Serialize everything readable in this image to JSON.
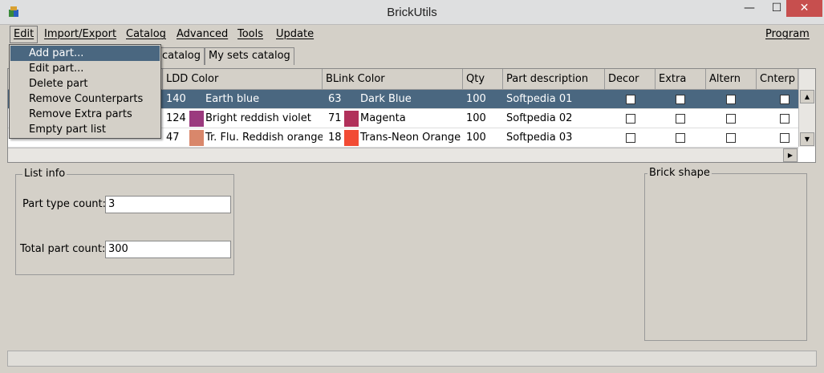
{
  "window": {
    "title": "BrickUtils",
    "minimize": "—",
    "maximize": "☐",
    "close": "✕"
  },
  "menubar": {
    "items": [
      "Edit",
      "Import/Export",
      "Catalog",
      "Advanced",
      "Tools",
      "Update"
    ],
    "right_item": "Program"
  },
  "tabs": [
    "catalog",
    "My sets catalog"
  ],
  "grid": {
    "columns": [
      "LDD Color",
      "BLink Color",
      "Qty",
      "Part description",
      "Decor",
      "Extra",
      "Altern",
      "Cnterp"
    ],
    "rows": [
      {
        "ldd_id": "140",
        "ldd_color": "Earth blue",
        "ldd_swatch": "#4a6780",
        "blink_id": "63",
        "blink_color": "Dark Blue",
        "blink_swatch": "#4a6780",
        "qty": "100",
        "description": "Softpedia 01",
        "selected": true
      },
      {
        "ldd_id": "124",
        "ldd_color": "Bright reddish violet",
        "ldd_swatch": "#9b3a7e",
        "blink_id": "71",
        "blink_color": "Magenta",
        "blink_swatch": "#b1305a",
        "qty": "100",
        "description": "Softpedia 02",
        "selected": false
      },
      {
        "ldd_id": "47",
        "ldd_color": "Tr. Flu. Reddish orange",
        "ldd_swatch": "#d9876b",
        "blink_id": "18",
        "blink_color": "Trans-Neon Orange",
        "blink_swatch": "#f24b34",
        "qty": "100",
        "description": "Softpedia 03",
        "selected": false
      }
    ]
  },
  "list_info": {
    "title": "List info",
    "part_type_label": "Part type count:",
    "part_type_value": "3",
    "total_part_label": "Total part count:",
    "total_part_value": "300"
  },
  "brick_shape": {
    "title": "Brick shape"
  },
  "edit_menu": {
    "items": [
      "Add part...",
      "Edit part...",
      "Delete part",
      "Remove Counterparts",
      "Remove Extra parts",
      "Empty part list"
    ],
    "highlighted_index": 0
  },
  "colors": {
    "selection": "#4a6780",
    "close_button": "#c74f4e",
    "background": "#d4d0c8"
  }
}
